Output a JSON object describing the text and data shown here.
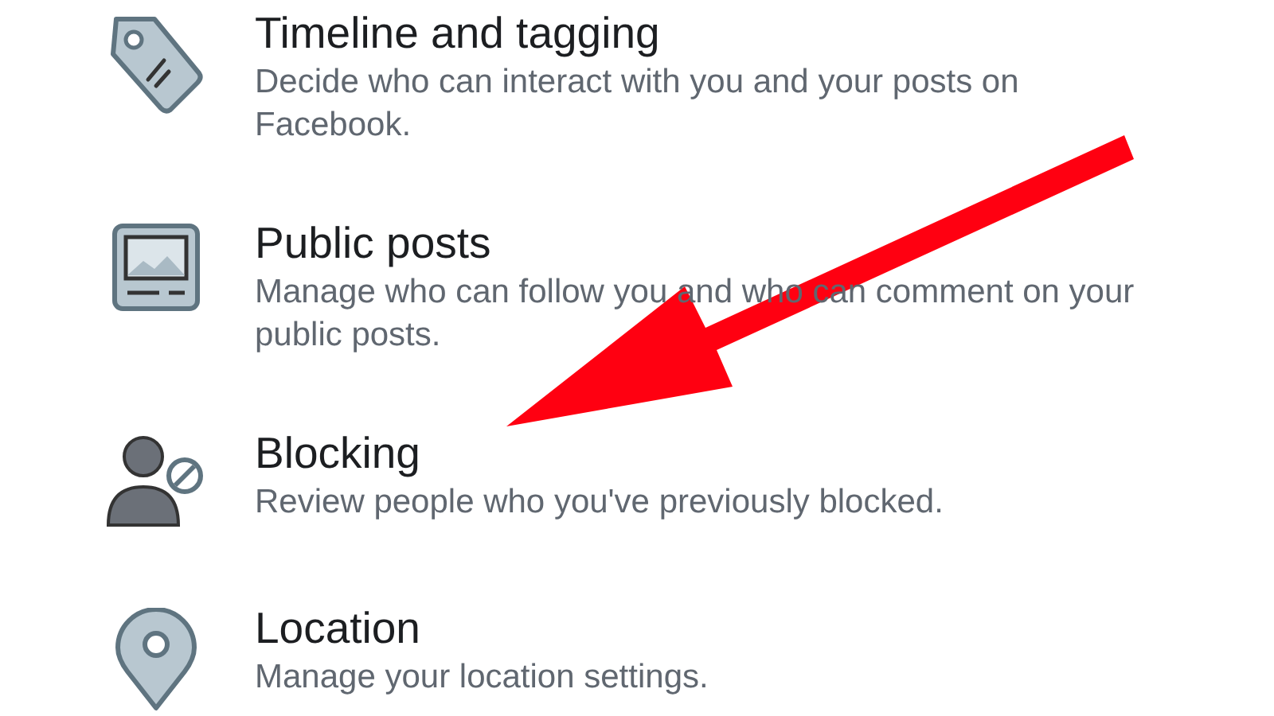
{
  "settings": [
    {
      "kind": "tag",
      "title": "Timeline and tagging",
      "description": "Decide who can interact with you and your posts on Facebook."
    },
    {
      "kind": "image",
      "title": "Public posts",
      "description": "Manage who can follow you and who can comment on your public posts."
    },
    {
      "kind": "block",
      "title": "Blocking",
      "description": "Review people who you've previously blocked."
    },
    {
      "kind": "pin",
      "title": "Location",
      "description": "Manage your location settings."
    }
  ]
}
